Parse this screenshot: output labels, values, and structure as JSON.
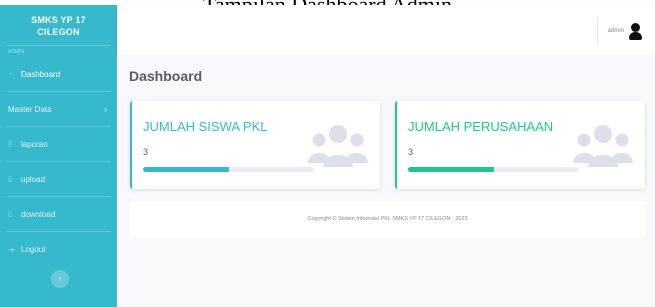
{
  "document": {
    "caption": "Tampilan Dashboard Admin"
  },
  "sidebar": {
    "brand_line1": "SMKS YP 17",
    "brand_line2": "CILEGON",
    "heading": "ADMIN",
    "items": [
      {
        "label": "Dashboard",
        "icon": "dashboard-icon",
        "active": true
      },
      {
        "label": "Master Data",
        "icon": "",
        "has_submenu": true
      },
      {
        "label": "laporan",
        "icon": "file-icon"
      },
      {
        "label": "upload",
        "icon": "upload-icon"
      },
      {
        "label": "download",
        "icon": "download-icon"
      },
      {
        "label": "Logout",
        "icon": "logout-icon"
      }
    ],
    "toggle_icon": "‹"
  },
  "topbar": {
    "user_name": "admin"
  },
  "main": {
    "title": "Dashboard",
    "cards": [
      {
        "title": "JUMLAH SISWA PKL",
        "value": "3",
        "progress": 0.5,
        "color": "#36b9cc",
        "icon": "users-icon"
      },
      {
        "title": "JUMLAH PERUSAHAAN",
        "value": "3",
        "progress": 0.5,
        "color": "#1cc88a",
        "icon": "users-icon"
      }
    ],
    "footer": "Copyright © Sistem Informasi PKL SMKS YP 17 CILEGON - 2023"
  },
  "colors": {
    "sidebar": "#36b9cc",
    "accent_info": "#36b9cc",
    "accent_success": "#1cc88a"
  }
}
